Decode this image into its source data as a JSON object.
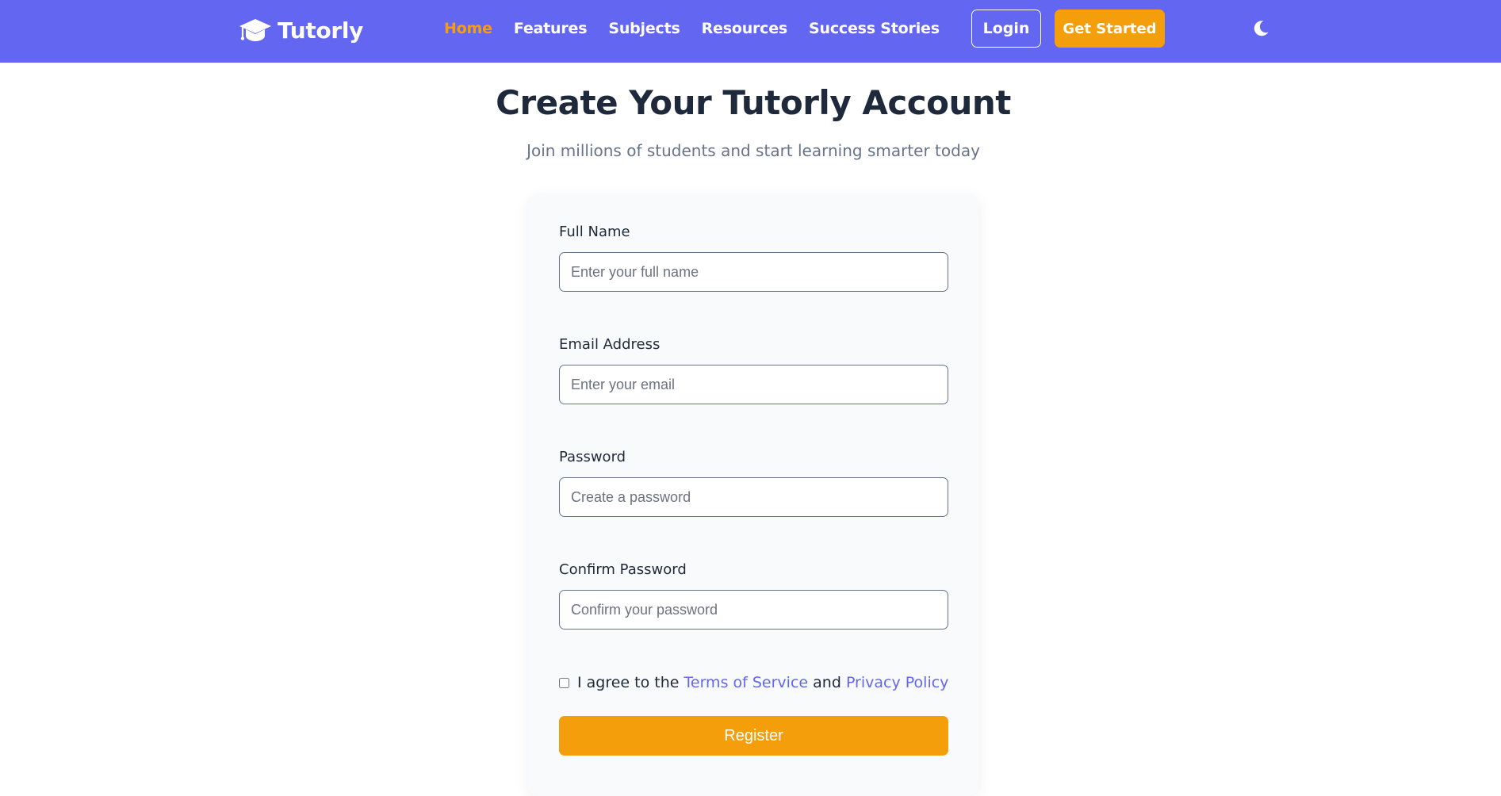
{
  "navbar": {
    "brand": {
      "icon": "graduation-cap-icon",
      "name": "Tutorly"
    },
    "links": [
      {
        "label": "Home",
        "active": true
      },
      {
        "label": "Features",
        "active": false
      },
      {
        "label": "Subjects",
        "active": false
      },
      {
        "label": "Resources",
        "active": false
      },
      {
        "label": "Success Stories",
        "active": false
      }
    ],
    "login_label": "Login",
    "get_started_label": "Get Started",
    "theme_toggle_icon": "moon-icon"
  },
  "page": {
    "title": "Create Your Tutorly Account",
    "subtitle": "Join millions of students and start learning smarter today"
  },
  "form": {
    "full_name": {
      "label": "Full Name",
      "placeholder": "Enter your full name",
      "value": ""
    },
    "email": {
      "label": "Email Address",
      "placeholder": "Enter your email",
      "value": ""
    },
    "password": {
      "label": "Password",
      "placeholder": "Create a password",
      "value": ""
    },
    "confirm_password": {
      "label": "Confirm Password",
      "placeholder": "Confirm your password",
      "value": ""
    },
    "terms": {
      "checked": false,
      "prefix": "I agree to the",
      "terms_link": "Terms of Service",
      "conjunction": "and",
      "privacy_link": "Privacy Policy"
    },
    "register_label": "Register"
  },
  "colors": {
    "primary": "#6366f1",
    "accent": "#f59e0b",
    "heading": "#1e293b",
    "muted": "#64748b",
    "card_bg": "#f8fafc"
  }
}
